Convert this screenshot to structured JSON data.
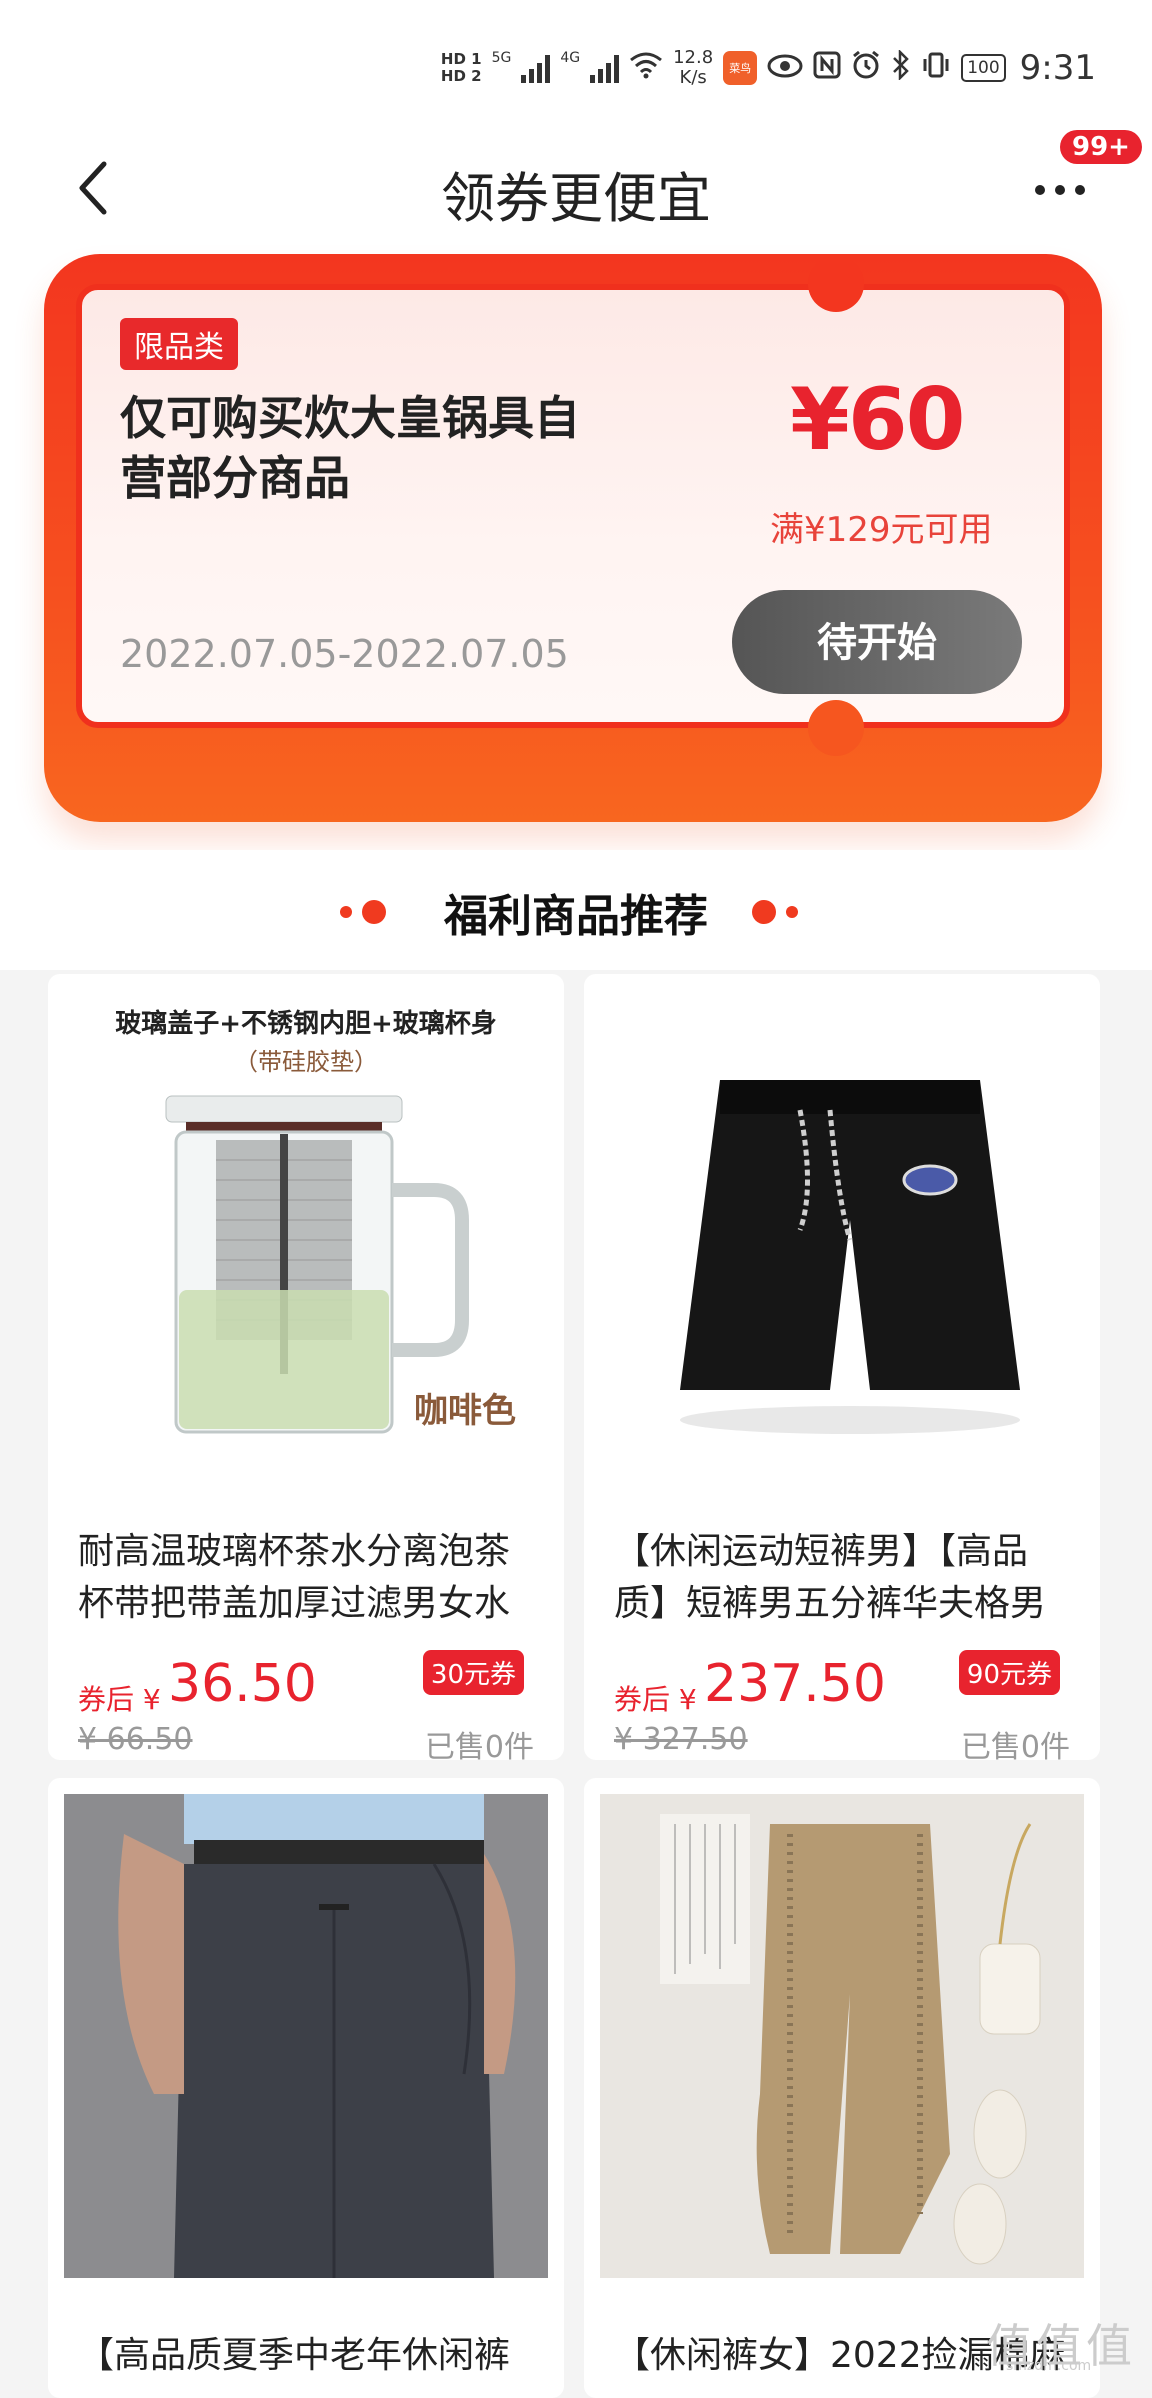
{
  "status_bar": {
    "hd1": "HD 1",
    "hd2": "HD 2",
    "net1": "5G",
    "net2": "4G",
    "speed": "12.8",
    "speed_unit": "K/s",
    "app_icon_text": "菜鸟",
    "battery": "100",
    "time": "9:31"
  },
  "nav": {
    "title": "领券更便宜",
    "badge": "99+"
  },
  "coupon": {
    "tag": "限品类",
    "description": "仅可购买炊大皇锅具自营部分商品",
    "date_range": "2022.07.05-2022.07.05",
    "amount": "¥60",
    "condition": "满¥129元可用",
    "button": "待开始"
  },
  "section": {
    "title": "福利商品推荐"
  },
  "products": [
    {
      "name": "耐高温玻璃杯茶水分离泡茶杯带把带盖加厚过滤男女水",
      "price_label": "券后 ¥",
      "price": "36.50",
      "coupon": "30元券",
      "original_price": "¥ 66.50",
      "sold": "已售0件",
      "img_caption_top": "玻璃盖子+不锈钢内胆+玻璃杯身",
      "img_caption_sub": "（带硅胶垫）",
      "img_caption_color": "咖啡色"
    },
    {
      "name": "【休闲运动短裤男】【高品质】短裤男五分裤华夫格男",
      "price_label": "券后 ¥",
      "price": "237.50",
      "coupon": "90元券",
      "original_price": "¥ 327.50",
      "sold": "已售0件"
    },
    {
      "name": "【高品质夏季中老年休闲裤",
      "image": "grey-trousers"
    },
    {
      "name": "【休闲裤女】2022捡漏棉麻",
      "image": "khaki-pants"
    }
  ],
  "watermark": "值值值",
  "watermark_url": "smzdm.com",
  "colors": {
    "accent": "#e8232e",
    "coupon_orange": "#f6501f",
    "button_gray": "#666666"
  }
}
